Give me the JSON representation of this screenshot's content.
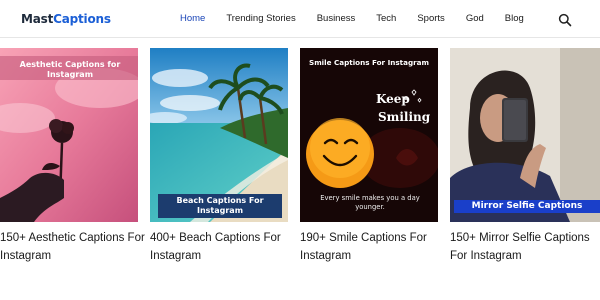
{
  "header": {
    "logo_main": "Mast",
    "logo_accent": "Captions",
    "nav": [
      {
        "label": "Home",
        "active": true
      },
      {
        "label": "Trending Stories",
        "active": false
      },
      {
        "label": "Business",
        "active": false
      },
      {
        "label": "Tech",
        "active": false
      },
      {
        "label": "Sports",
        "active": false
      },
      {
        "label": "God",
        "active": false
      },
      {
        "label": "Blog",
        "active": false
      }
    ],
    "search_icon": "search-icon"
  },
  "cards": [
    {
      "overlay": "Aesthetic Captions for Instagram",
      "title": "150+ Aesthetic Captions For Instagram"
    },
    {
      "overlay": "Beach Captions For Instagram",
      "title": "400+ Beach Captions For Instagram"
    },
    {
      "overlay": "Smile Captions For Instagram",
      "keep_line1": "Keep",
      "keep_line2": "Smiling",
      "subtext": "Every smile makes you a day younger.",
      "title": "190+ Smile Captions For Instagram"
    },
    {
      "overlay": "Mirror Selfie Captions",
      "title": "150+ Mirror Selfie Captions For Instagram"
    }
  ],
  "colors": {
    "accent": "#1b46b8",
    "logo_accent": "#1b5fd6",
    "beach_label_bg": "#1c3c6e",
    "mirror_label_bg": "#1a3fc9"
  }
}
